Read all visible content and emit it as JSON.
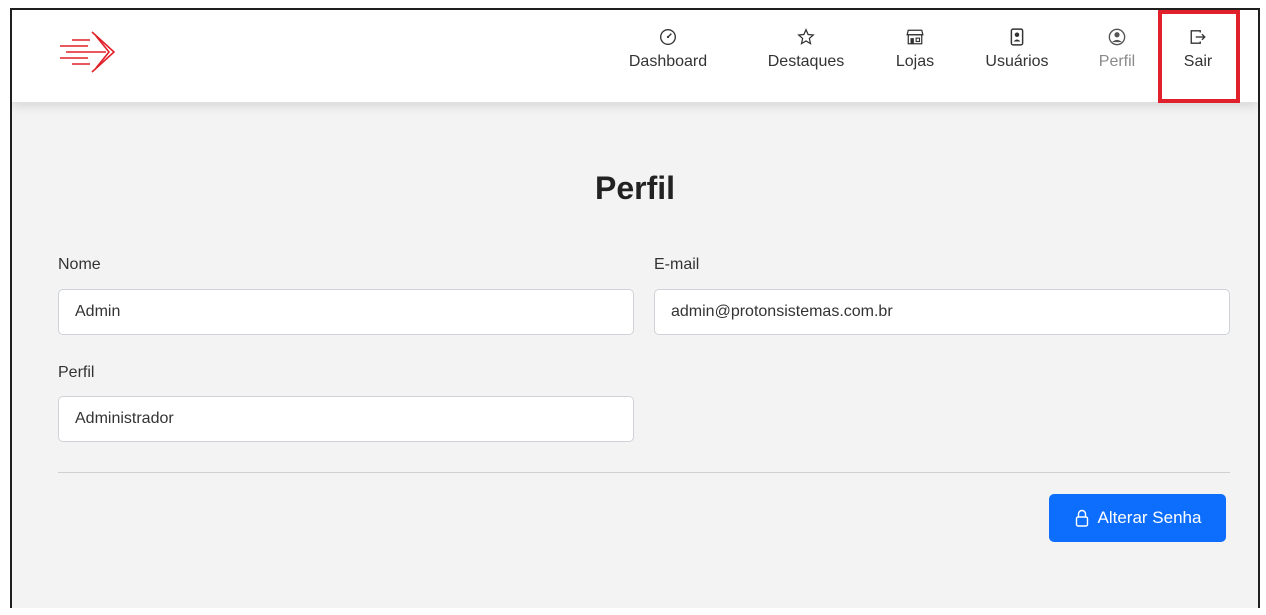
{
  "nav": {
    "items": [
      {
        "label": "Dashboard",
        "icon": "speedometer-icon"
      },
      {
        "label": "Destaques",
        "icon": "star-icon"
      },
      {
        "label": "Lojas",
        "icon": "shop-icon"
      },
      {
        "label": "Usuários",
        "icon": "person-badge-icon"
      },
      {
        "label": "Perfil",
        "icon": "person-circle-icon"
      },
      {
        "label": "Sair",
        "icon": "box-arrow-right-icon"
      }
    ]
  },
  "page": {
    "title": "Perfil"
  },
  "form": {
    "nome_label": "Nome",
    "nome_value": "Admin",
    "email_label": "E-mail",
    "email_value": "admin@protonsistemas.com.br",
    "perfil_label": "Perfil",
    "perfil_value": "Administrador"
  },
  "actions": {
    "change_password_label": "Alterar Senha"
  },
  "colors": {
    "accent": "#0d6efd",
    "brand": "#e0202a",
    "highlight": "#e0202a"
  }
}
